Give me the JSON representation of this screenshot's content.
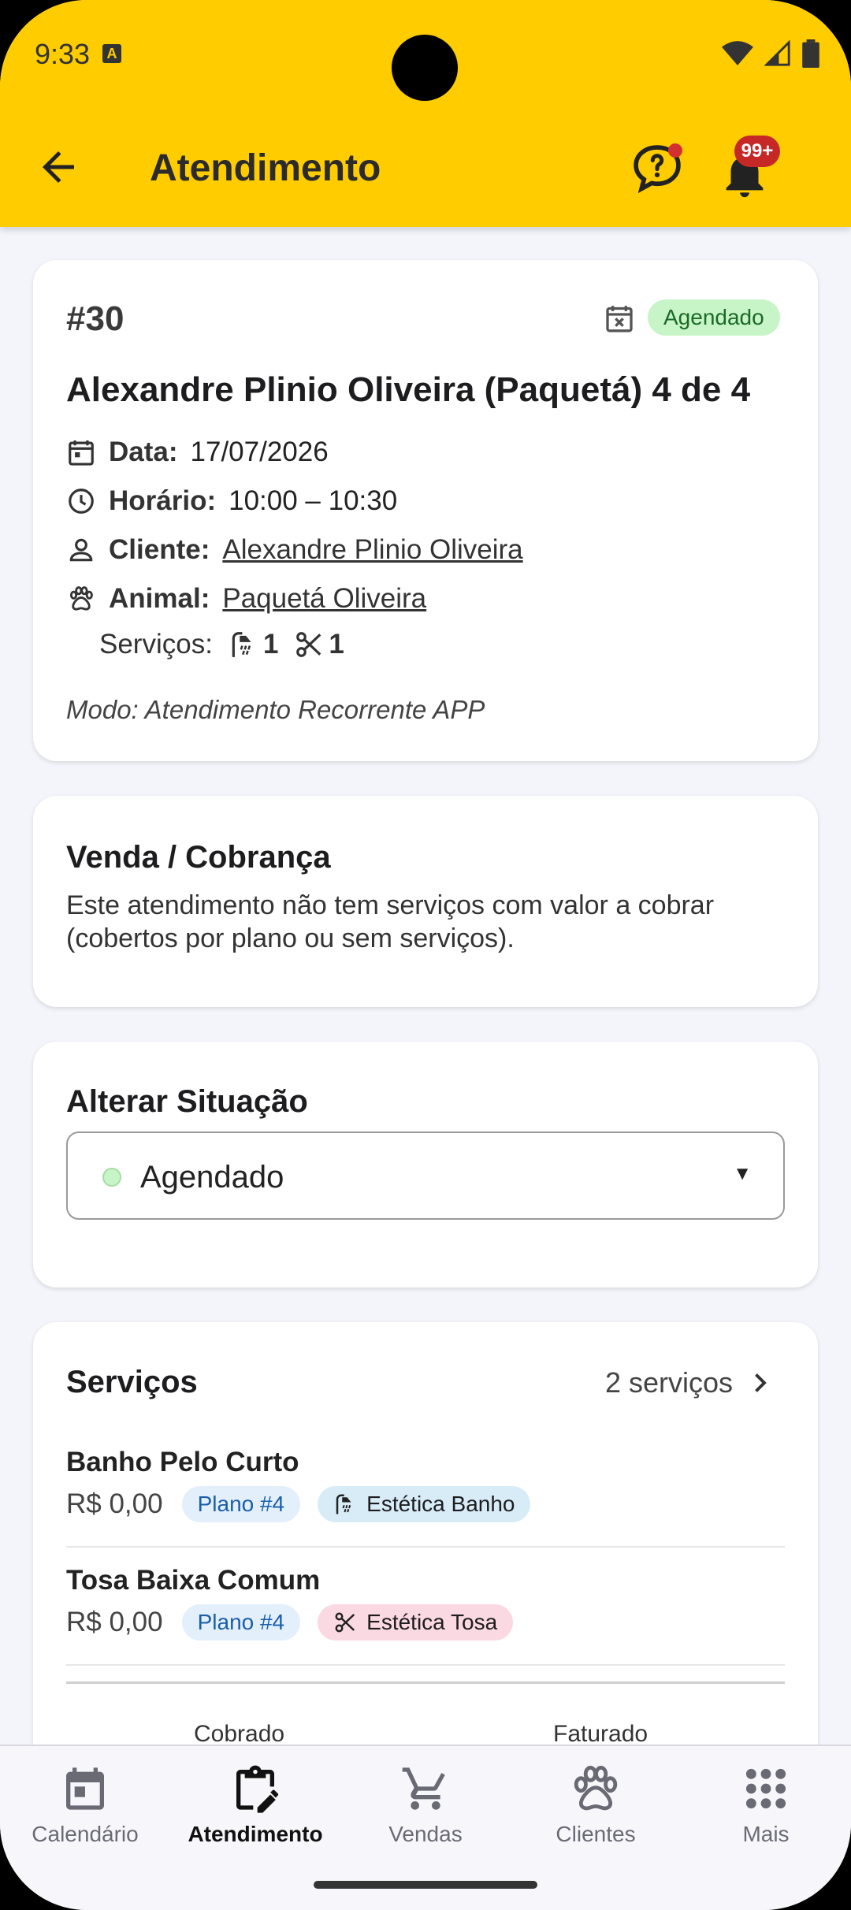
{
  "status_bar": {
    "time": "9:33",
    "a_label": "A"
  },
  "app_bar": {
    "title": "Atendimento",
    "notifications_badge": "99+"
  },
  "appointment": {
    "number": "#30",
    "status": "Agendado",
    "title": "Alexandre Plinio Oliveira (Paquetá) 4 de 4",
    "date_label": "Data:",
    "date": "17/07/2026",
    "time_label": "Horário:",
    "time": "10:00 – 10:30",
    "client_label": "Cliente:",
    "client": "Alexandre Plinio Oliveira",
    "animal_label": "Animal:",
    "animal": "Paquetá Oliveira",
    "services_label": "Serviços:",
    "bath_count": "1",
    "grooming_count": "1",
    "mode": "Modo: Atendimento Recorrente APP"
  },
  "billing": {
    "title": "Venda / Cobrança",
    "description": "Este atendimento não tem serviços com valor a cobrar (cobertos por plano ou sem serviços)."
  },
  "change_status": {
    "title": "Alterar Situação",
    "selected": "Agendado"
  },
  "services": {
    "title": "Serviços",
    "count": "2 serviços",
    "items": [
      {
        "name": "Banho Pelo Curto",
        "price": "R$ 0,00",
        "plan": "Plano #4",
        "category": "Estética Banho"
      },
      {
        "name": "Tosa Baixa Comum",
        "price": "R$ 0,00",
        "plan": "Plano #4",
        "category": "Estética Tosa"
      }
    ],
    "footer_charged": "Cobrado",
    "footer_invoiced": "Faturado"
  },
  "bottom_nav": [
    {
      "label": "Calendário"
    },
    {
      "label": "Atendimento"
    },
    {
      "label": "Vendas"
    },
    {
      "label": "Clientes"
    },
    {
      "label": "Mais"
    }
  ],
  "colors": {
    "accent": "#ffcc00",
    "status_bg": "#c8f5c8",
    "plan_chip": "#e3f0fb",
    "bath_chip": "#d8ecf8",
    "grooming_chip": "#fbd9e2"
  }
}
